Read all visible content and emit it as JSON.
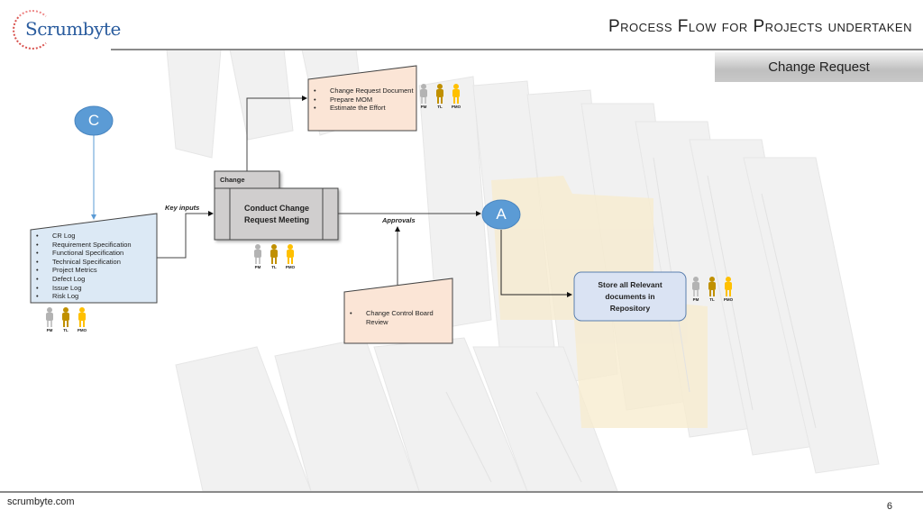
{
  "header": {
    "logo_text": "Scrumbyte",
    "title": "Process Flow for Projects undertaken",
    "section": "Change Request"
  },
  "footer": {
    "site": "scrumbyte.com",
    "page_number": "6"
  },
  "colors": {
    "connector_blue": "#5b9bd5",
    "input_box_fill": "#dce9f5",
    "output_box_fill": "#fbe5d6",
    "process_fill": "#d0cece",
    "repository_fill": "#dae3f3",
    "role_pm": "#b3b3b3",
    "role_tl": "#c09000",
    "role_pmo": "#ffc000"
  },
  "diagram": {
    "connector_c": "C",
    "connector_a": "A",
    "inputs_box": {
      "items": [
        "CR Log",
        "Requirement Specification",
        "Functional Specification",
        "Technical Specification",
        "Project Metrics",
        "Defect Log",
        "Issue Log",
        "Risk Log"
      ]
    },
    "process": {
      "tab": "Change",
      "label_line1": "Conduct Change",
      "label_line2": "Request Meeting"
    },
    "outputs_box": {
      "items": [
        "Change Request Document",
        "Prepare MOM",
        "Estimate the Effort"
      ]
    },
    "review_box": {
      "items": [
        "Change Control Board Review"
      ]
    },
    "repository": {
      "line1": "Store all  Relevant",
      "line2": "documents in",
      "line3": "Repository"
    },
    "edge_labels": {
      "key_inputs": "Key inputs",
      "approvals": "Approvals"
    },
    "roles": [
      "PM",
      "TL",
      "PMO"
    ]
  }
}
